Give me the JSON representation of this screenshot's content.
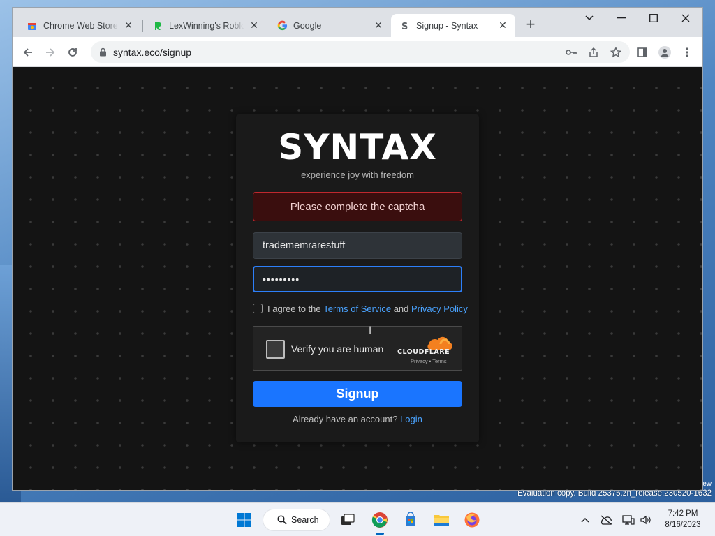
{
  "browser": {
    "tabs": [
      {
        "title": "Chrome Web Store -",
        "icon": "chrome-web-store-icon",
        "active": false
      },
      {
        "title": "LexWinning's Roblox",
        "icon": "green-r-icon",
        "active": false
      },
      {
        "title": "Google",
        "icon": "google-g-icon",
        "active": false
      },
      {
        "title": "Signup - Syntax",
        "icon": "syntax-s-icon",
        "active": true
      }
    ],
    "url": "syntax.eco/signup"
  },
  "page": {
    "logo": "SYNTAX",
    "tagline": "experience joy with freedom",
    "alert": "Please complete the captcha",
    "username_value": "tradememrarestuff",
    "password_value": "•••••••••",
    "agree": {
      "prefix": "I agree to the",
      "tos": "Terms of Service",
      "and": "and",
      "privacy": "Privacy Policy"
    },
    "captcha": {
      "label": "Verify you are human",
      "brand": "CLOUDFLARE",
      "links": "Privacy  •  Terms"
    },
    "signup_label": "Signup",
    "login_prompt": "Already have an account?",
    "login_link": "Login"
  },
  "desktop": {
    "eval_note": "Evaluation copy. Build 25375.zn_release.230520-1632",
    "corner_text": "ew"
  },
  "taskbar": {
    "search_label": "Search",
    "time": "7:42 PM",
    "date": "8/16/2023"
  },
  "colors": {
    "accent": "#1a75ff",
    "alert_border": "#c0282e",
    "link": "#4aa3ff"
  }
}
